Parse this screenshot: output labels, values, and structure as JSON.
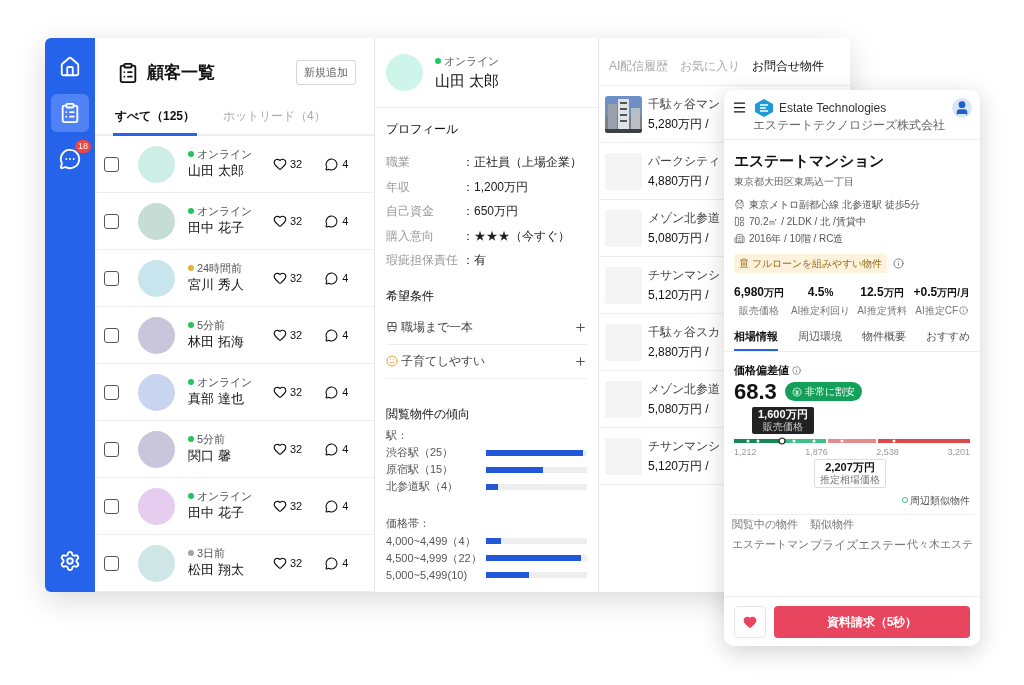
{
  "sidebar": {
    "items": [
      {
        "kind": "home",
        "selected": false
      },
      {
        "kind": "list",
        "selected": true
      },
      {
        "kind": "chat",
        "selected": false,
        "badge": "18"
      }
    ]
  },
  "customers": {
    "title": "顧客一覧",
    "add_button": "新規追加",
    "tabs": [
      {
        "label": "すべて（125）",
        "selected": true
      },
      {
        "label": "ホットリード（4）",
        "selected": false
      }
    ],
    "rows": [
      {
        "checked": false,
        "status": "オンライン",
        "color": "#22c55e",
        "avatar": {
          "color": "#cdeee6"
        },
        "name": "山田 太郎",
        "likes": "32",
        "comments": "4"
      },
      {
        "checked": false,
        "status": "オンライン",
        "color": "#22c55e",
        "avatar": {
          "color": "#c6ddd5"
        },
        "name": "田中 花子",
        "likes": "32",
        "comments": "4"
      },
      {
        "checked": false,
        "status": "24時間前",
        "color": "#f0ad3c",
        "avatar": {
          "color": "#c8e4ec"
        },
        "name": "宮川 秀人",
        "likes": "32",
        "comments": "4"
      },
      {
        "checked": false,
        "status": "5分前",
        "color": "#22c55e",
        "avatar": {
          "color": "#c9c6dc"
        },
        "name": "林田 拓海",
        "likes": "32",
        "comments": "4"
      },
      {
        "checked": false,
        "status": "オンライン",
        "color": "#22c55e",
        "avatar": {
          "color": "#c9d5f0"
        },
        "name": "真部 達也",
        "likes": "32",
        "comments": "4"
      },
      {
        "checked": false,
        "status": "5分前",
        "color": "#22c55e",
        "avatar": {
          "color": "#c9c6dc"
        },
        "name": "関口 馨",
        "likes": "32",
        "comments": "4"
      },
      {
        "checked": false,
        "status": "オンライン",
        "color": "#22c55e",
        "avatar": {
          "color": "#e6cdf0"
        },
        "name": "田中 花子",
        "likes": "32",
        "comments": "4"
      },
      {
        "checked": false,
        "status": "3日前",
        "color": "#a3a3a3",
        "avatar": {
          "color": "#cfe6e6"
        },
        "name": "松田 翔太",
        "likes": "32",
        "comments": "4"
      }
    ]
  },
  "detail": {
    "status": "オンライン",
    "color": "#22c55e",
    "name": "山田 太郎",
    "profile_title": "プロフィール",
    "profile": [
      {
        "label": "職業",
        "value": "：正社員（上場企業）"
      },
      {
        "label": "年収",
        "value": "：1,200万円"
      },
      {
        "label": "自己資金",
        "value": "：650万円"
      },
      {
        "label": "購入意向",
        "value": "：★★★（今すぐ）"
      },
      {
        "label": "瑕疵担保責任",
        "value": "：有"
      }
    ],
    "wishes_title": "希望条件",
    "wishes": [
      {
        "kind": "train",
        "label": "職場まで一本"
      },
      {
        "kind": "face",
        "label": "子育てしやすい"
      }
    ],
    "trends_title": "閲覧物件の傾向",
    "trend_groups": [
      {
        "label": "駅：",
        "items": [
          {
            "label": "渋谷駅（25）",
            "level": 0.96
          },
          {
            "label": "原宿駅（15）",
            "level": 0.56
          },
          {
            "label": "北参道駅（4）",
            "level": 0.12
          }
        ]
      },
      {
        "label": "価格帯：",
        "items": [
          {
            "label": "4,000~4,499（4）",
            "level": 0.15
          },
          {
            "label": "4,500~4,999（22）",
            "level": 0.94
          },
          {
            "label": "5,000~5,499(10)",
            "level": 0.43
          }
        ]
      }
    ]
  },
  "properties": {
    "tabs": [
      {
        "label": "AI配信履歴",
        "selected": false
      },
      {
        "label": "お気に入り",
        "selected": false
      },
      {
        "label": "お問合せ物件",
        "selected": true
      }
    ],
    "items": [
      {
        "kind": "picture",
        "name": "千駄ヶ谷マン",
        "price": "5,280万円 /"
      },
      {
        "kind": "blank",
        "name": "パークシティ",
        "price": "4,880万円 /"
      },
      {
        "kind": "blank",
        "name": "メゾン北参道",
        "price": "5,080万円 /"
      },
      {
        "kind": "blank",
        "name": "チサンマンシ",
        "price": "5,120万円 /"
      },
      {
        "kind": "blank",
        "name": "千駄ヶ谷スカ",
        "price": "2,880万円 /"
      },
      {
        "kind": "blank",
        "name": "メゾン北参道",
        "price": "5,080万円 /"
      },
      {
        "kind": "blank",
        "name": "チサンマンシ",
        "price": "5,120万円 /"
      }
    ]
  },
  "phone": {
    "brand": "Estate Technologies",
    "brand_sub": "エステートテクノロジーズ株式会社",
    "title": "エステートマンション",
    "address": "東京都大田区東馬込一丁目",
    "facts": [
      {
        "kind": "train",
        "text": "東京メトロ副都心線 北参道駅 徒歩5分"
      },
      {
        "kind": "layout",
        "text": "70.2㎡ / 2LDK / 北 /賃貸中"
      },
      {
        "kind": "building",
        "text": "2016年 / 10階 / RC造"
      }
    ],
    "tag": "フルローンを組みやすい物件",
    "stats": [
      {
        "value": "6,980",
        "unit": "万円",
        "label": "販売価格",
        "info": false
      },
      {
        "value": "4.5",
        "unit": "%",
        "label": "AI推定利回り",
        "info": false
      },
      {
        "value": "12.5",
        "unit": "万円",
        "label": "AI推定賃料",
        "info": false
      },
      {
        "value": "+0.5",
        "unit": "万円/月",
        "label": "AI推定CF",
        "info": true
      }
    ],
    "tabs": [
      {
        "label": "相場情報",
        "selected": true
      },
      {
        "label": "周辺環境",
        "selected": false
      },
      {
        "label": "物件概要",
        "selected": false
      },
      {
        "label": "おすすめ",
        "selected": false
      }
    ],
    "score_title": "価格偏差値",
    "score": "68.3",
    "score_badge": "非常に割安",
    "scale": {
      "ticks": [
        "1,212",
        "1,876",
        "2,538",
        "3,201"
      ],
      "sale_value": "1,600",
      "sale_unit": "万円",
      "sale_label": "販売価格",
      "estimate_value": "2,207",
      "estimate_unit": "万円",
      "estimate_label": "推定相場価格",
      "legend": "周辺類似物件"
    },
    "compare": {
      "columns": [
        "閲覧中の物件",
        "類似物件"
      ],
      "cells": [
        "エステートマン",
        "プライズエステー",
        "代々木エステ"
      ]
    },
    "favorite": true,
    "cta": "資料請求（5秒）"
  }
}
